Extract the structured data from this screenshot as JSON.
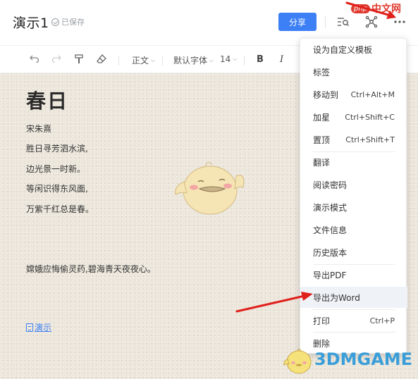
{
  "header": {
    "doc_title": "演示1",
    "saved_status": "已保存",
    "share_label": "分享"
  },
  "watermark_top": {
    "badge": "php",
    "text": "中文网"
  },
  "toolbar": {
    "paragraph_style": "正文",
    "font_family": "默认字体",
    "font_size": "14",
    "bold": "B",
    "italic": "I"
  },
  "doc": {
    "title": "春日",
    "lines": [
      "宋朱熹",
      "胜日寻芳泗水滨,",
      "边光景一时新。",
      "等闲识得东风面,",
      "万紫千红总是春。",
      "嫦娥应悔偷灵药,碧海青天夜夜心。"
    ],
    "link_text": "演示"
  },
  "menu": {
    "items": [
      {
        "label": "设为自定义模板",
        "shortcut": ""
      },
      {
        "label": "标签",
        "shortcut": ""
      },
      {
        "label": "移动到",
        "shortcut": "Ctrl+Alt+M"
      },
      {
        "label": "加星",
        "shortcut": "Ctrl+Shift+C"
      },
      {
        "label": "置顶",
        "shortcut": "Ctrl+Shift+T"
      },
      {
        "label": "翻译",
        "shortcut": ""
      },
      {
        "label": "阅读密码",
        "shortcut": ""
      },
      {
        "label": "演示模式",
        "shortcut": ""
      },
      {
        "label": "文件信息",
        "shortcut": ""
      },
      {
        "label": "历史版本",
        "shortcut": ""
      },
      {
        "label": "导出PDF",
        "shortcut": ""
      },
      {
        "label": "导出为Word",
        "shortcut": ""
      },
      {
        "label": "打印",
        "shortcut": "Ctrl+P"
      },
      {
        "label": "删除",
        "shortcut": ""
      }
    ],
    "highlighted_index": 11
  },
  "watermark_bottom": {
    "text": "3DMGAME"
  },
  "colors": {
    "accent": "#3d7ff5",
    "arrow": "#e0201b",
    "watermark": "#3a9ed9"
  }
}
